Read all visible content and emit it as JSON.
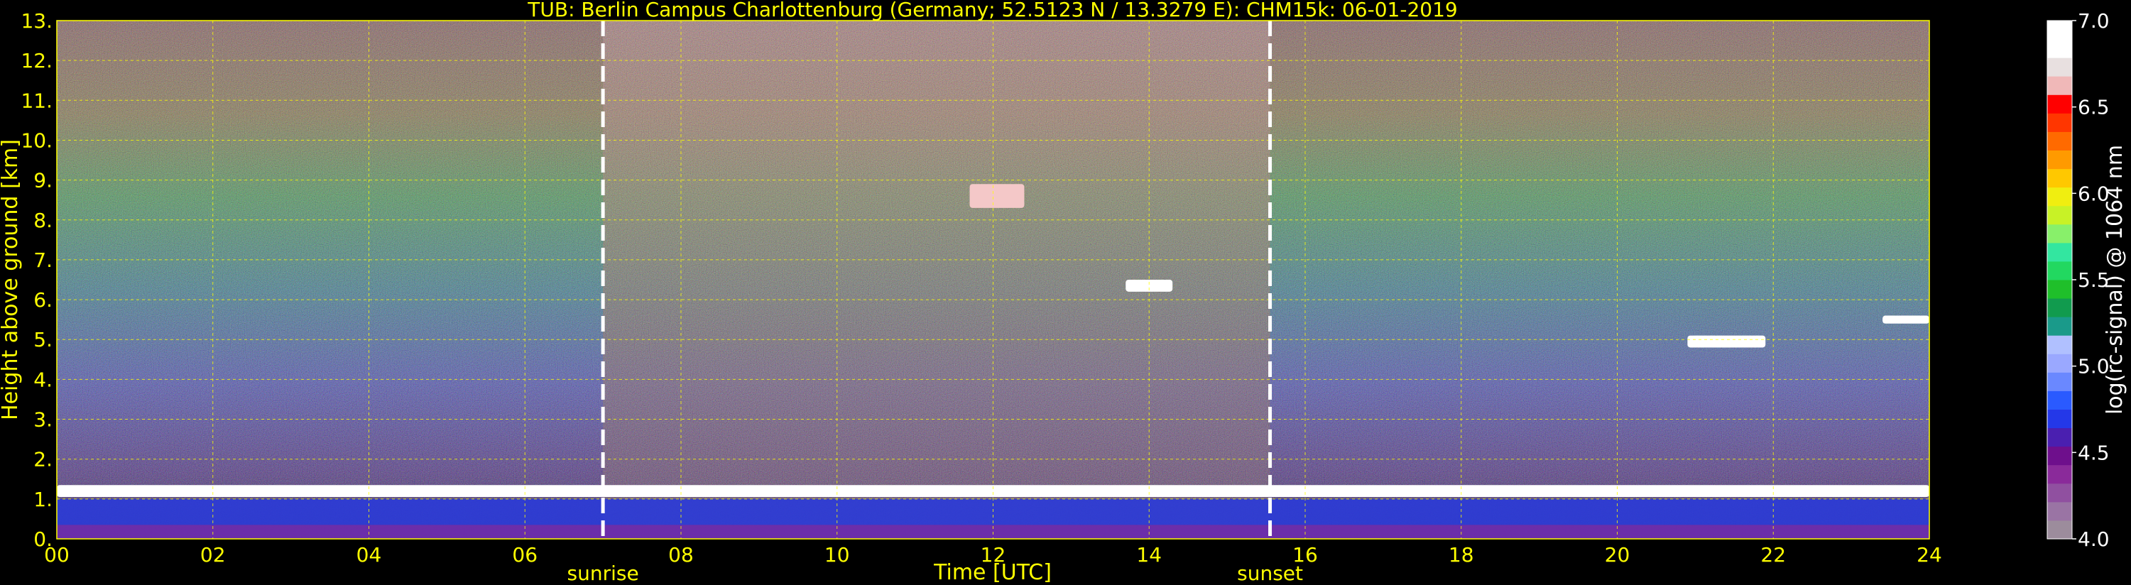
{
  "chart_data": {
    "type": "heatmap",
    "title": "TUB: Berlin Campus Charlottenburg (Germany; 52.5123 N / 13.3279 E):    CHM15k: 06-01-2019",
    "xlabel": "Time [UTC]",
    "ylabel": "Height above ground [km]",
    "xlim": [
      0,
      24
    ],
    "ylim": [
      0,
      13
    ],
    "x_ticks": [
      0,
      2,
      4,
      6,
      8,
      10,
      12,
      14,
      16,
      18,
      20,
      22,
      24
    ],
    "x_tick_labels": [
      "00",
      "02",
      "04",
      "06",
      "08",
      "10",
      "12",
      "14",
      "16",
      "18",
      "20",
      "22",
      "24"
    ],
    "y_ticks": [
      0,
      1,
      2,
      3,
      4,
      5,
      6,
      7,
      8,
      9,
      10,
      11,
      12,
      13
    ],
    "y_tick_labels": [
      "0.",
      "1.",
      "2.",
      "3.",
      "4.",
      "5.",
      "6.",
      "7.",
      "8.",
      "9.",
      "10.",
      "11.",
      "12.",
      "13."
    ],
    "grid": true,
    "events": [
      {
        "label": "sunrise",
        "time": 7.0
      },
      {
        "label": "sunset",
        "time": 15.55
      }
    ],
    "colorbar": {
      "label": "log(rc-signal) @ 1064 nm",
      "range": [
        4.0,
        7.0
      ],
      "ticks": [
        4.0,
        4.5,
        5.0,
        5.5,
        6.0,
        6.5,
        7.0
      ],
      "tick_labels": [
        "4.0",
        "4.5",
        "5.0",
        "5.5",
        "6.0",
        "6.5",
        "7.0"
      ],
      "colors": [
        "#9c8c9c",
        "#9a74a4",
        "#9050a0",
        "#8a2a9a",
        "#6e0f8c",
        "#4a1fb0",
        "#2438e8",
        "#2a5aff",
        "#6a88ff",
        "#9aa8ff",
        "#b0c0ff",
        "#1a9a8a",
        "#119b4e",
        "#1fbf2a",
        "#22d860",
        "#33e6a0",
        "#88f06a",
        "#c8f226",
        "#f0ee10",
        "#ffc800",
        "#ff9a00",
        "#ff6a00",
        "#ff3600",
        "#ff0000",
        "#f0b8b8",
        "#e8e0e0",
        "#ffffff",
        "#ffffff"
      ]
    },
    "cloud_layers": [
      {
        "t_start": 0.0,
        "t_end": 24.0,
        "base_km": 1.05,
        "top_km": 1.35,
        "note_color": "white"
      },
      {
        "t_start": 11.7,
        "t_end": 12.4,
        "base_km": 8.3,
        "top_km": 8.9,
        "note_color": "pink"
      },
      {
        "t_start": 13.7,
        "t_end": 14.3,
        "base_km": 6.2,
        "top_km": 6.5,
        "note_color": "white"
      },
      {
        "t_start": 20.9,
        "t_end": 21.9,
        "base_km": 4.8,
        "top_km": 5.1,
        "note_color": "white"
      },
      {
        "t_start": 23.4,
        "t_end": 24.0,
        "base_km": 5.4,
        "top_km": 5.6,
        "note_color": "white"
      }
    ]
  }
}
